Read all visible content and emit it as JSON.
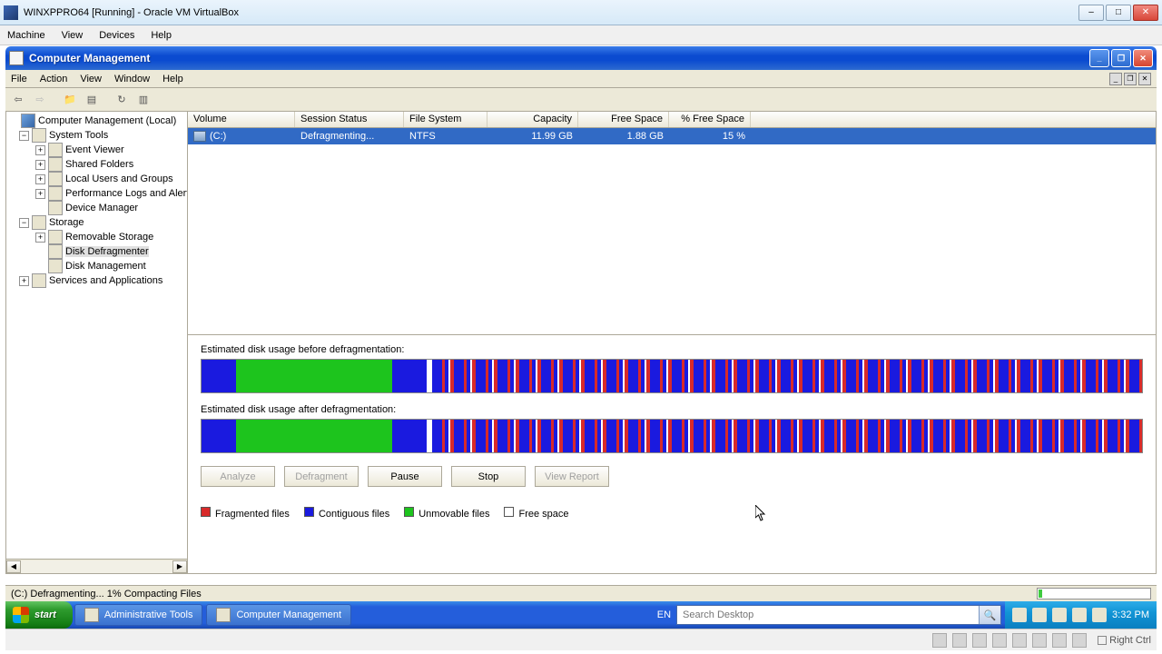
{
  "vbox": {
    "title": "WINXPPRO64 [Running] - Oracle VM VirtualBox",
    "menu": [
      "Machine",
      "View",
      "Devices",
      "Help"
    ],
    "hostkey": "Right Ctrl"
  },
  "cm": {
    "title": "Computer Management",
    "menu": [
      "File",
      "Action",
      "View",
      "Window",
      "Help"
    ]
  },
  "tree": {
    "root": "Computer Management (Local)",
    "systools": "System Tools",
    "event": "Event Viewer",
    "shared": "Shared Folders",
    "local": "Local Users and Groups",
    "perf": "Performance Logs and Alerts",
    "devmgr": "Device Manager",
    "storage": "Storage",
    "remov": "Removable Storage",
    "defrag": "Disk Defragmenter",
    "diskmgmt": "Disk Management",
    "services": "Services and Applications"
  },
  "cols": {
    "volume": "Volume",
    "session": "Session Status",
    "fs": "File System",
    "capacity": "Capacity",
    "free": "Free Space",
    "pctfree": "% Free Space",
    "w_volume": 118,
    "w_session": 120,
    "w_fs": 92,
    "w_capacity": 100,
    "w_free": 100,
    "w_pctfree": 90
  },
  "row": {
    "volume": "(C:)",
    "session": "Defragmenting...",
    "fs": "NTFS",
    "capacity": "11.99 GB",
    "free": "1.88 GB",
    "pctfree": "15 %"
  },
  "defrag": {
    "before_label": "Estimated disk usage before defragmentation:",
    "after_label": "Estimated disk usage after defragmentation:",
    "analyze": "Analyze",
    "defragment": "Defragment",
    "pause": "Pause",
    "stop": "Stop",
    "report": "View Report",
    "legend_frag": "Fragmented files",
    "legend_cont": "Contiguous files",
    "legend_unmov": "Unmovable files",
    "legend_free": "Free space"
  },
  "status": {
    "text": "(C:) Defragmenting... 1%  Compacting Files"
  },
  "taskbar": {
    "start": "start",
    "admin": "Administrative Tools",
    "cm": "Computer Management",
    "lang": "EN",
    "search_placeholder": "Search Desktop",
    "clock": "3:32 PM"
  }
}
